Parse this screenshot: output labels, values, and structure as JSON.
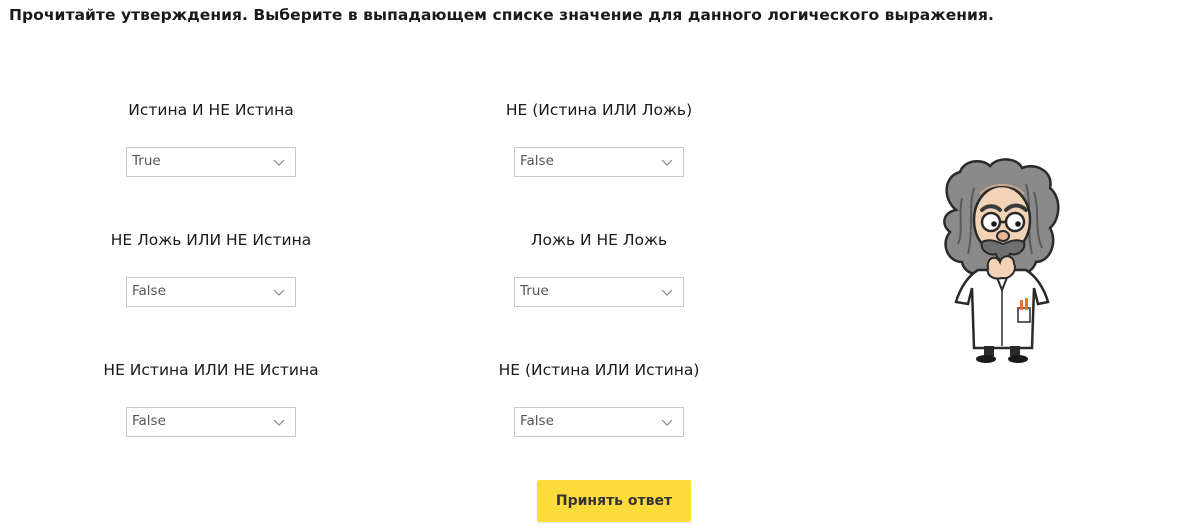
{
  "instruction": "Прочитайте утверждения. Выберите в выпадающем списке значение для данного логического выражения.",
  "questions": [
    {
      "expression": "Истина И НЕ Истина",
      "selected": "True"
    },
    {
      "expression": "НЕ (Истина ИЛИ Ложь)",
      "selected": "False"
    },
    {
      "expression": "НЕ Ложь ИЛИ НЕ Истина",
      "selected": "False"
    },
    {
      "expression": "Ложь И НЕ Ложь",
      "selected": "True"
    },
    {
      "expression": "НЕ Истина ИЛИ НЕ Истина",
      "selected": "False"
    },
    {
      "expression": "НЕ (Истина ИЛИ Истина)",
      "selected": "False"
    }
  ],
  "submit_label": "Принять ответ",
  "colors": {
    "submit_button": "#fddb3a",
    "select_border": "#c8c8c8",
    "text": "#1a1a1a"
  },
  "icons": {
    "dropdown": "chevron-down-icon",
    "mascot": "professor-mascot-illustration"
  }
}
